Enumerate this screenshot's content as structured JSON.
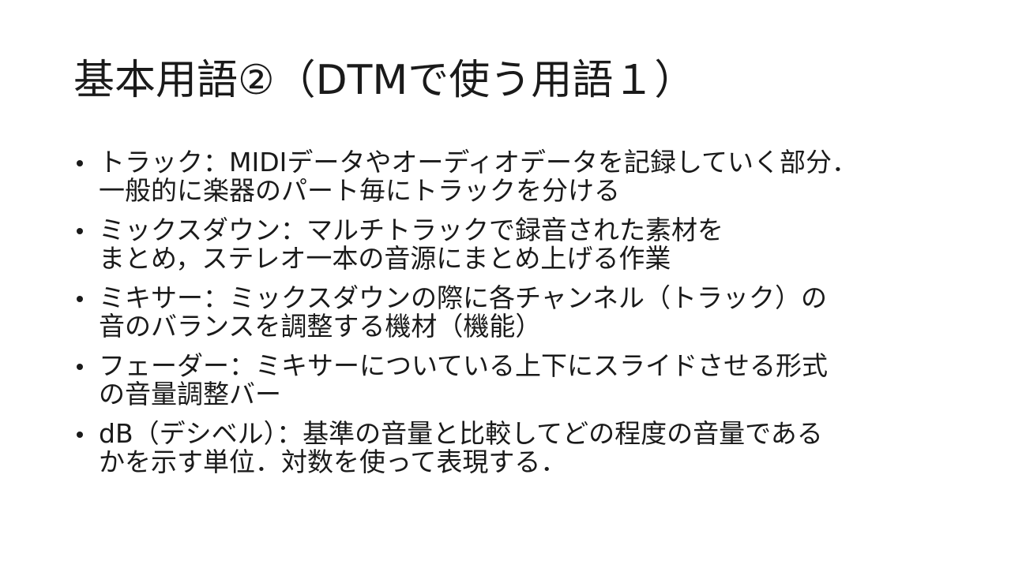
{
  "slide": {
    "title": "基本用語②（DTMで使う用語１）",
    "bullets": [
      {
        "line1": "トラック：MIDIデータやオーディオデータを記録していく部分．",
        "line2": "一般的に楽器のパート毎にトラックを分ける"
      },
      {
        "line1": "ミックスダウン：マルチトラックで録音された素材を",
        "line2": "まとめ，ステレオ一本の音源にまとめ上げる作業"
      },
      {
        "line1": "ミキサー：ミックスダウンの際に各チャンネル（トラック）の",
        "line2": "音のバランスを調整する機材（機能）"
      },
      {
        "line1": "フェーダー：ミキサーについている上下にスライドさせる形式",
        "line2": "の音量調整バー"
      },
      {
        "line1": "dB（デシベル）：基準の音量と比較してどの程度の音量である",
        "line2": "かを示す単位．対数を使って表現する．"
      }
    ]
  },
  "colors": {
    "background": "#ffffff",
    "text": "#1a1a1a"
  }
}
